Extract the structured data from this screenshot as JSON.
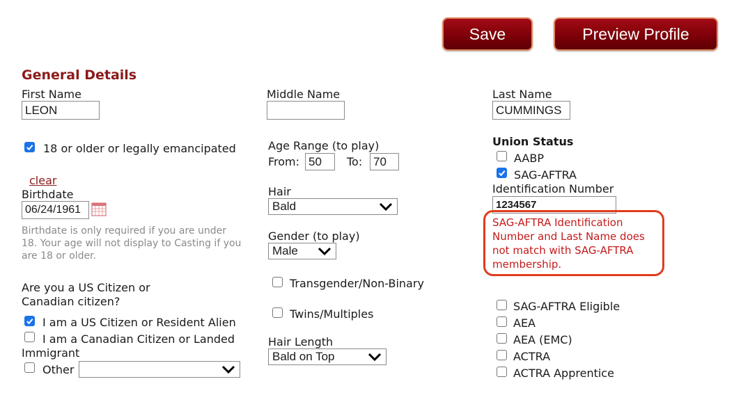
{
  "toolbar": {
    "save_label": "Save",
    "preview_label": "Preview Profile"
  },
  "general": {
    "title": "General Details",
    "first_name_label": "First Name",
    "first_name_value": "LEON",
    "middle_name_label": "Middle Name",
    "middle_name_value": "",
    "last_name_label": "Last Name",
    "last_name_value": "CUMMINGS",
    "adult_label": "18 or older or legally emancipated",
    "adult_checked": true,
    "clear_label": "clear",
    "birthdate_label": "Birthdate",
    "birthdate_value": "06/24/1961",
    "birthdate_note": "Birthdate is only required if you are under 18. Your age will not display to Casting if you are 18 or older.",
    "citizen_question": "Are you a US Citizen or Canadian citizen?",
    "citizen_us_label": "I am a US Citizen or Resident Alien",
    "citizen_ca_label": "I am a Canadian Citizen or Landed Immigrant",
    "citizen_other_label": "Other",
    "citizen_other_value": ""
  },
  "physical": {
    "age_range_label": "Age Range (to play)",
    "from_label": "From:",
    "from_value": "50",
    "to_label": "To:",
    "to_value": "70",
    "hair_label": "Hair",
    "hair_value": "Bald",
    "gender_label": "Gender (to play)",
    "gender_value": "Male",
    "transgender_label": "Transgender/Non-Binary",
    "twins_label": "Twins/Multiples",
    "hair_length_label": "Hair Length",
    "hair_length_value": "Bald on Top"
  },
  "union": {
    "title": "Union Status",
    "aabp_label": "AABP",
    "sag_label": "SAG-AFTRA",
    "id_label": "Identification Number",
    "id_value": "1234567",
    "error_message": "SAG-AFTRA Identification Number and Last Name does not match with SAG-AFTRA membership.",
    "sag_eligible_label": "SAG-AFTRA Eligible",
    "aea_label": "AEA",
    "aea_emc_label": "AEA (EMC)",
    "actra_label": "ACTRA",
    "actra_apprentice_label": "ACTRA Apprentice"
  },
  "colors": {
    "accent": "#8b1a1a",
    "checkbox": "#1a73e8",
    "error": "#c41a1a",
    "error_border": "#e03c1e"
  },
  "icons": {
    "calendar": "calendar-icon",
    "chevron": "chevron-down-icon",
    "check": "check-icon"
  }
}
